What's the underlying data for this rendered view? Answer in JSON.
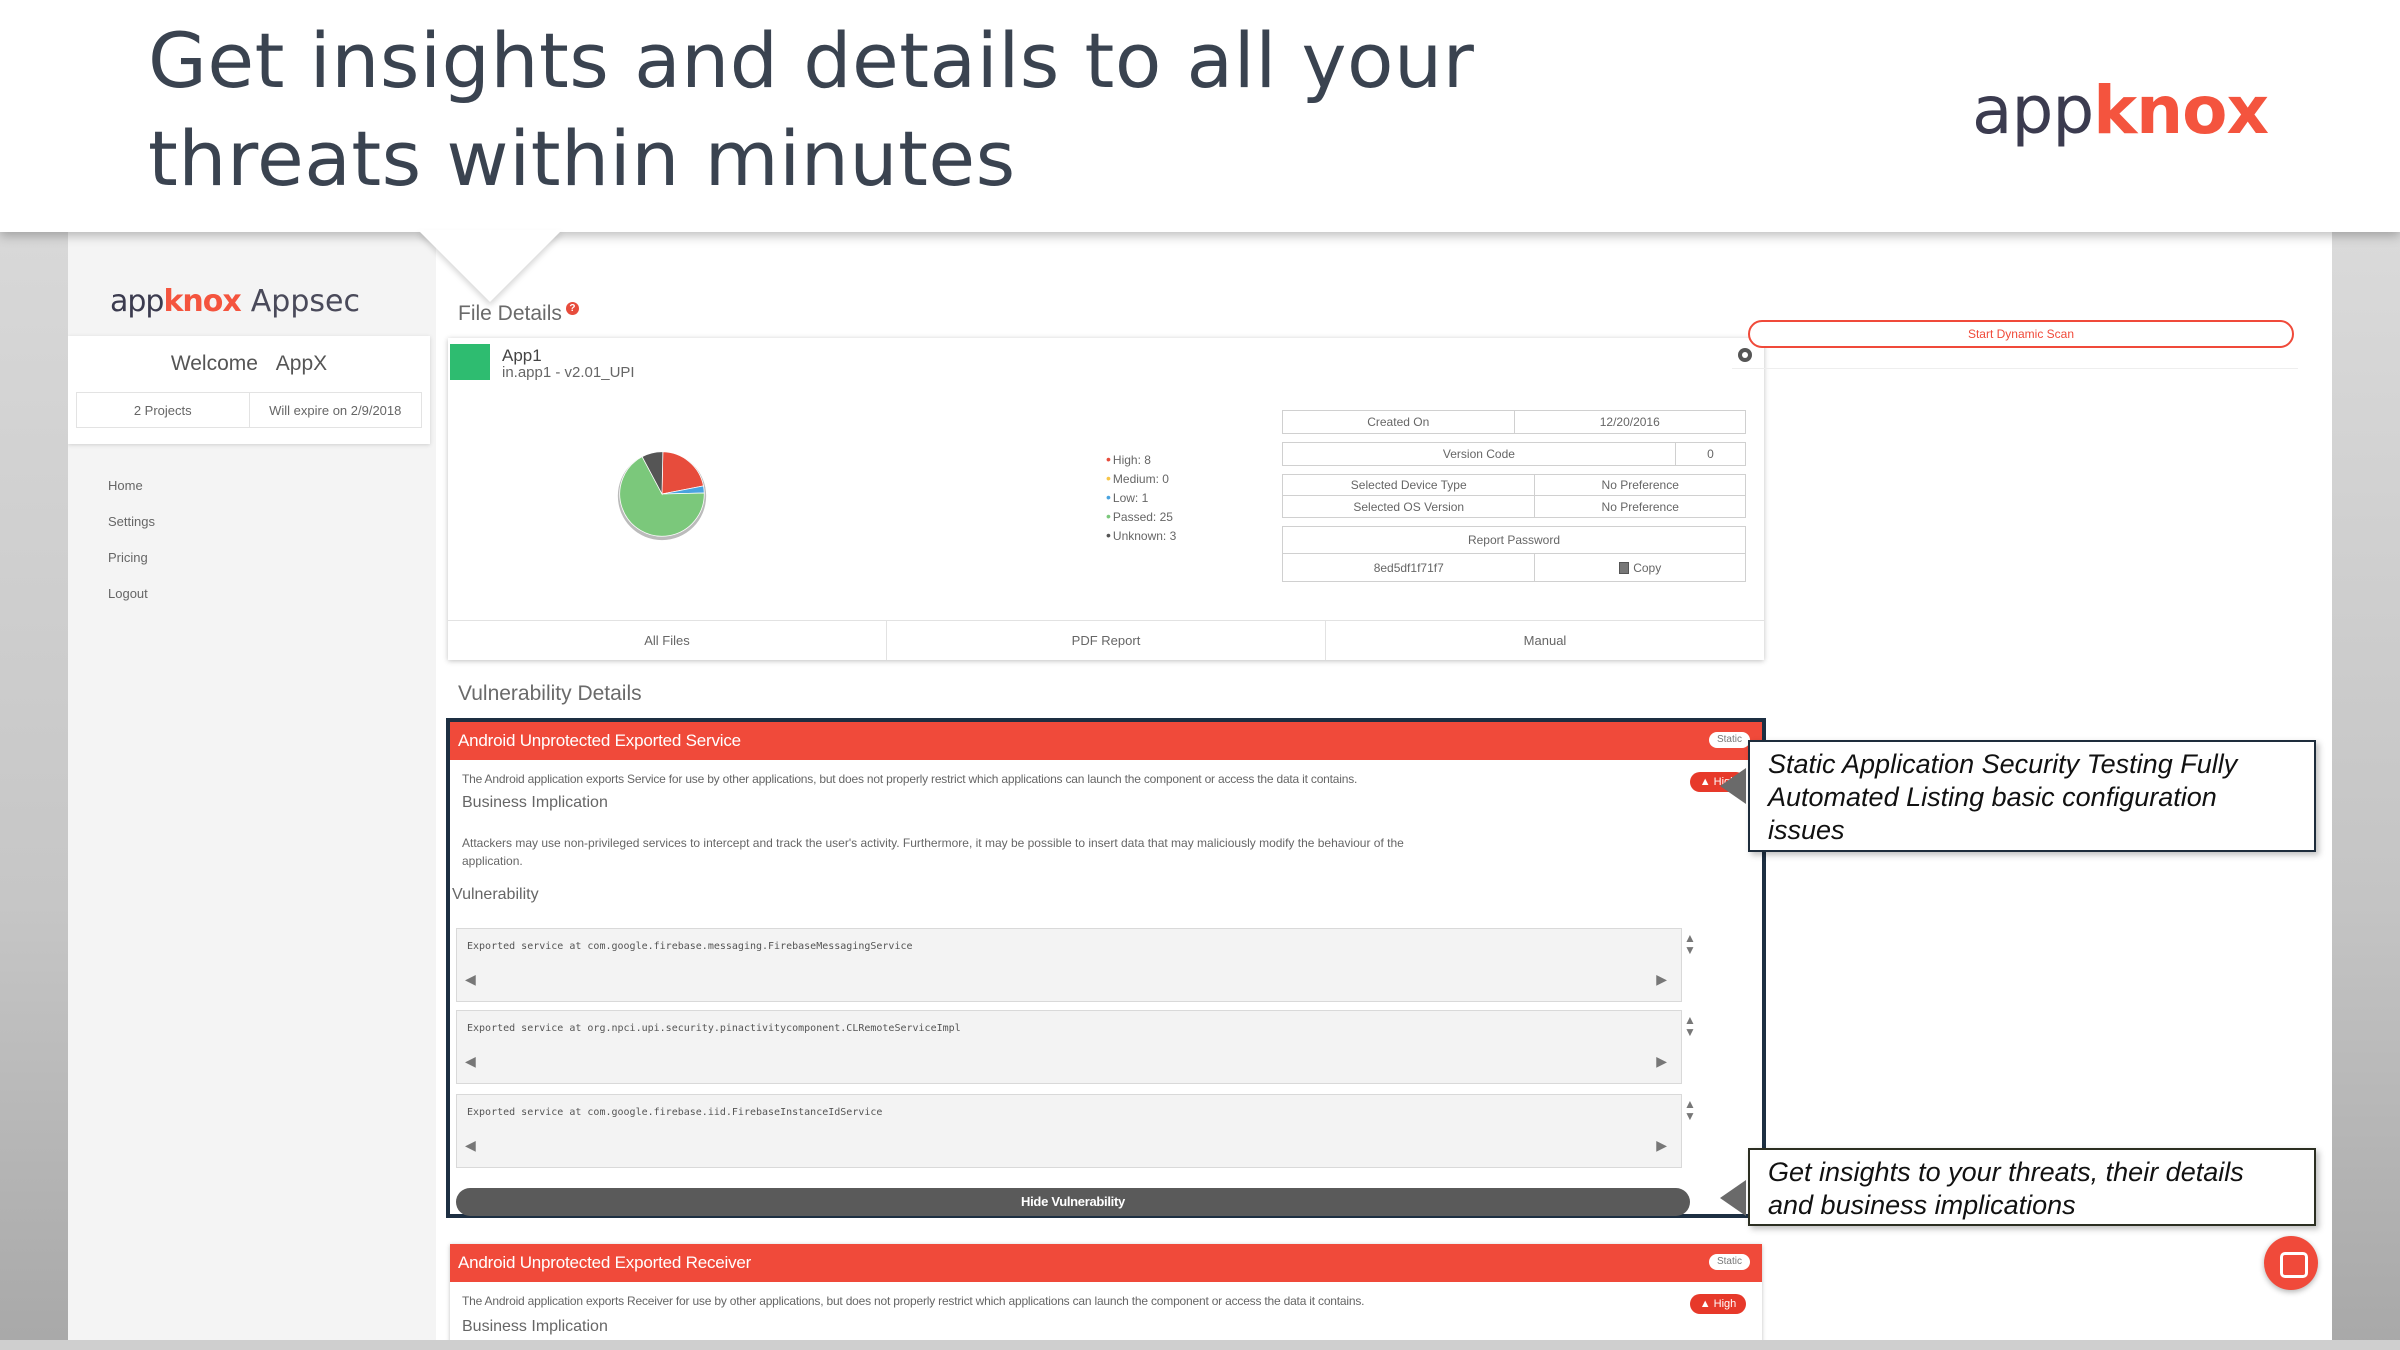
{
  "slide": {
    "title": "Get insights and details to all your threats within minutes",
    "logo": {
      "part1": "app",
      "part2": "knox"
    }
  },
  "sidebar": {
    "brand": {
      "part1": "app",
      "part2": "knox",
      "suffix": "Appsec"
    },
    "welcome_label": "Welcome",
    "user_name": "AppX",
    "projects": "2 Projects",
    "expiry": "Will expire on 2/9/2018",
    "nav": [
      {
        "label": "Home"
      },
      {
        "label": "Settings"
      },
      {
        "label": "Pricing"
      },
      {
        "label": "Logout"
      }
    ]
  },
  "file_details": {
    "heading": "File Details",
    "help_icon": "?",
    "file_name": "App1",
    "package": "in.app1 - v2.01_UPI",
    "colors": {
      "tag": "#2ebc70"
    },
    "severity": [
      {
        "label": "High: 8",
        "value": 8,
        "color": "#e74c3c"
      },
      {
        "label": "Medium: 0",
        "value": 0,
        "color": "#f7c548"
      },
      {
        "label": "Low: 1",
        "value": 1,
        "color": "#4aa3df"
      },
      {
        "label": "Passed: 25",
        "value": 25,
        "color": "#7bc87b"
      },
      {
        "label": "Unknown: 3",
        "value": 3,
        "color": "#555555"
      }
    ],
    "meta": {
      "created_on_label": "Created On",
      "created_on_value": "12/20/2016",
      "version_code_label": "Version Code",
      "version_code_value": "0",
      "device_type_label": "Selected Device Type",
      "device_type_value": "No Preference",
      "os_version_label": "Selected OS Version",
      "os_version_value": "No Preference",
      "report_password_label": "Report Password",
      "report_password_value": "8ed5df1f71f7",
      "copy_label": "Copy"
    },
    "tabs": [
      "All Files",
      "PDF Report",
      "Manual"
    ]
  },
  "vulnerabilities": {
    "heading": "Vulnerability Details",
    "items": [
      {
        "title": "Android Unprotected Exported Service",
        "badge": "Static",
        "severity_label": "High",
        "description": "The Android application exports Service for use by other applications, but does not properly restrict which applications can launch the component or access the data it contains.",
        "impact_heading": "Business Implication",
        "impact": "Attackers may use non-privileged services to intercept and track the user's activity. Furthermore, it may be possible to insert data that may maliciously modify the behaviour of the application.",
        "vuln_heading": "Vulnerability",
        "findings": [
          "Exported service at com.google.firebase.messaging.FirebaseMessagingService",
          "Exported service at org.npci.upi.security.pinactivitycomponent.CLRemoteServiceImpl",
          "Exported service at com.google.firebase.iid.FirebaseInstanceIdService"
        ],
        "hide_button": "Hide Vulnerability"
      },
      {
        "title": "Android Unprotected Exported Receiver",
        "badge": "Static",
        "severity_label": "High",
        "description": "The Android application exports Receiver for use by other applications, but does not properly restrict which applications can launch the component or access the data it contains.",
        "impact_heading": "Business Implication"
      }
    ]
  },
  "actions": {
    "dynamic_scan": "Start Dynamic Scan"
  },
  "callouts": [
    "Static Application Security Testing Fully Automated Listing basic configuration issues",
    "Get insights to your threats, their details and business implications"
  ],
  "colors": {
    "accent": "#f04a3a",
    "high": "#e7392a"
  }
}
